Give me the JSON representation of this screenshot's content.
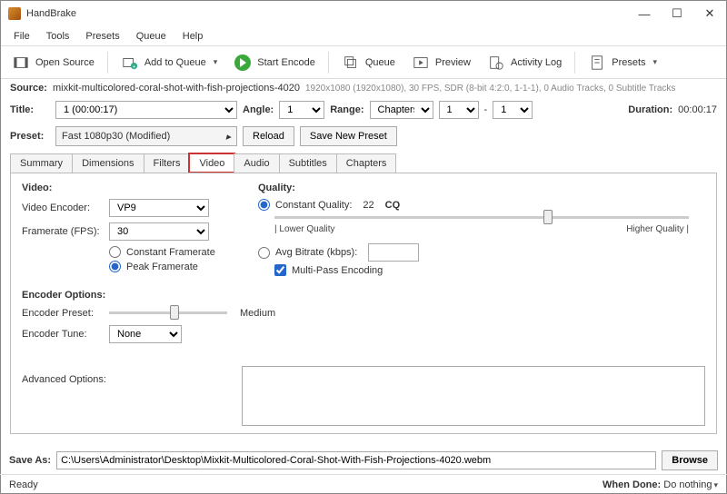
{
  "titlebar": {
    "app_name": "HandBrake"
  },
  "menu": {
    "file": "File",
    "tools": "Tools",
    "presets": "Presets",
    "queue": "Queue",
    "help": "Help"
  },
  "toolbar": {
    "open_source": "Open Source",
    "add_to_queue": "Add to Queue",
    "start_encode": "Start Encode",
    "queue": "Queue",
    "preview": "Preview",
    "activity_log": "Activity Log",
    "presets": "Presets"
  },
  "source": {
    "label": "Source:",
    "value": "mixkit-multicolored-coral-shot-with-fish-projections-4020",
    "info": "1920x1080 (1920x1080), 30 FPS, SDR (8-bit 4:2:0, 1-1-1), 0 Audio Tracks, 0 Subtitle Tracks"
  },
  "title_row": {
    "title_label": "Title:",
    "title_value": "1  (00:00:17)",
    "angle_label": "Angle:",
    "angle_value": "1",
    "range_label": "Range:",
    "range_type": "Chapters",
    "range_start": "1",
    "range_sep": "-",
    "range_end": "1",
    "duration_label": "Duration:",
    "duration_value": "00:00:17"
  },
  "preset_row": {
    "label": "Preset:",
    "value": "Fast 1080p30  (Modified)",
    "reload": "Reload",
    "save_new": "Save New Preset"
  },
  "tabs": {
    "summary": "Summary",
    "dimensions": "Dimensions",
    "filters": "Filters",
    "video": "Video",
    "audio": "Audio",
    "subtitles": "Subtitles",
    "chapters": "Chapters"
  },
  "video": {
    "hdr_video": "Video:",
    "encoder_label": "Video Encoder:",
    "encoder_value": "VP9",
    "framerate_label": "Framerate (FPS):",
    "framerate_value": "30",
    "constant_fr": "Constant Framerate",
    "peak_fr": "Peak Framerate",
    "hdr_quality": "Quality:",
    "constant_quality": "Constant Quality:",
    "cq_value": "22",
    "cq_suffix": "CQ",
    "lower": "| Lower Quality",
    "higher": "Higher Quality |",
    "avg_bitrate": "Avg Bitrate (kbps):",
    "multi_pass": "Multi-Pass Encoding",
    "hdr_encopts": "Encoder Options:",
    "enc_preset_label": "Encoder Preset:",
    "enc_preset_value": "Medium",
    "enc_tune_label": "Encoder Tune:",
    "enc_tune_value": "None",
    "adv_opts_label": "Advanced Options:"
  },
  "save_as": {
    "label": "Save As:",
    "value": "C:\\Users\\Administrator\\Desktop\\Mixkit-Multicolored-Coral-Shot-With-Fish-Projections-4020.webm",
    "browse": "Browse"
  },
  "status": {
    "ready": "Ready",
    "when_done_label": "When Done:",
    "when_done_value": "Do nothing"
  }
}
